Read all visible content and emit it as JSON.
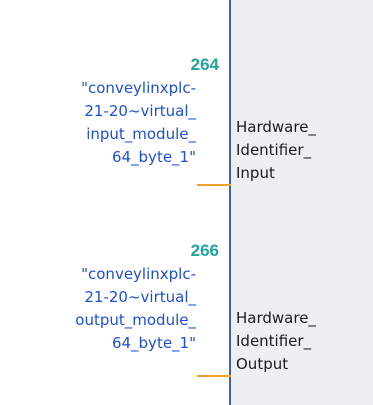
{
  "params": [
    {
      "address": "264",
      "tag_lines": [
        "\"conveylinxplc-",
        "21-20~virtual_",
        "input_module_",
        "64_byte_1\""
      ],
      "pin_lines": [
        "Hardware_",
        "Identifier_",
        "Input"
      ]
    },
    {
      "address": "266",
      "tag_lines": [
        "\"conveylinxplc-",
        "21-20~virtual_",
        "output_module_",
        "64_byte_1\""
      ],
      "pin_lines": [
        "Hardware_",
        "Identifier_",
        "Output"
      ]
    }
  ],
  "colors": {
    "address": "#21a59c",
    "tag": "#1f4fd8",
    "wire": "#f0a12c",
    "block_border": "#3f5fa0",
    "block_fill": "#edeff2"
  }
}
